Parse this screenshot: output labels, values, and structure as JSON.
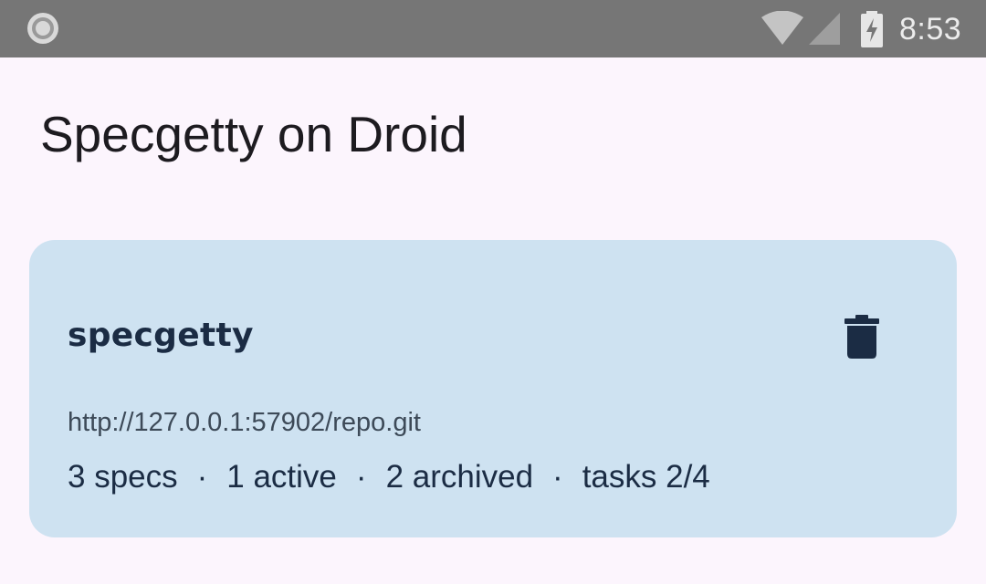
{
  "status_bar": {
    "time": "8:53",
    "icons": [
      "record-icon",
      "wifi-icon",
      "signal-icon",
      "battery-charging-icon"
    ],
    "background": "#767676"
  },
  "app": {
    "title": "Specgetty on Droid",
    "background": "#fcf5fd"
  },
  "repo_card": {
    "name": "specgetty",
    "url": "http://127.0.0.1:57902/repo.git",
    "stats": {
      "specs": "3 specs",
      "active": "1 active",
      "archived": "2 archived",
      "tasks": "tasks 2/4",
      "separator": "·"
    },
    "delete_icon": "trash-icon",
    "card_color": "#cee2f1",
    "text_color": "#1b2c44"
  }
}
